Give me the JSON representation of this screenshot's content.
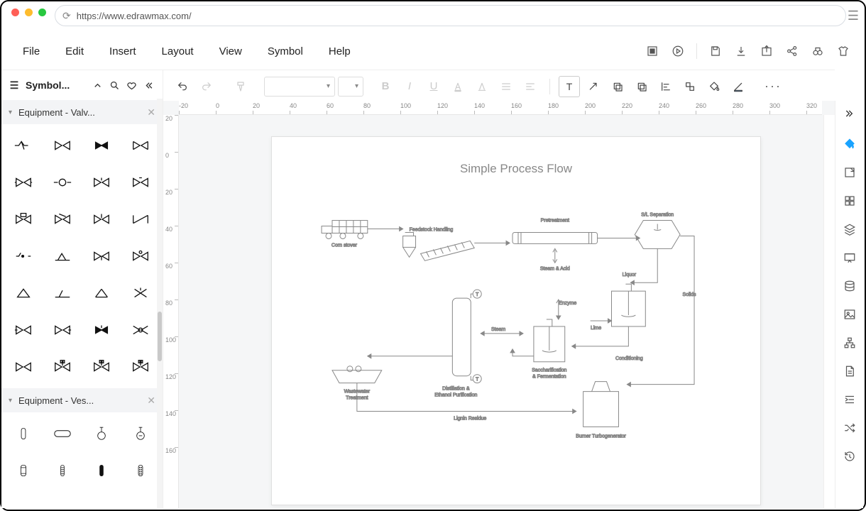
{
  "url": "https://www.edrawmax.com/",
  "menubar": {
    "items": [
      "File",
      "Edit",
      "Insert",
      "Layout",
      "View",
      "Symbol",
      "Help"
    ]
  },
  "right_top_icons": [
    "fullscreen-icon",
    "play-icon",
    "save-icon",
    "download-icon",
    "export-icon",
    "share-icon",
    "binoculars-icon",
    "shirt-icon"
  ],
  "left": {
    "heading": "Symbol...",
    "cat1": "Equipment - Valv...",
    "cat2": "Equipment - Ves..."
  },
  "ruler_h": [
    "-20",
    "0",
    "20",
    "40",
    "60",
    "80",
    "100",
    "120",
    "140",
    "160",
    "180",
    "200",
    "220",
    "240",
    "260",
    "280",
    "300",
    "320"
  ],
  "ruler_v": [
    "20",
    "0",
    "20",
    "40",
    "60",
    "80",
    "100",
    "120",
    "140",
    "160"
  ],
  "diagram": {
    "title": "Simple Process Flow",
    "labels": {
      "corn_stover": "Corn stover",
      "feedstock": "Feedstock Handling",
      "pretreatment": "Pretreatment",
      "sl_sep": "S/L Separation",
      "steam_acid": "Steam & Acid",
      "liquor": "Liquor",
      "solids": "Solids",
      "steam": "Steam",
      "enzyme": "Enzyme",
      "lime": "Lime",
      "conditioning": "Conditioning",
      "sacc_ferm1": "Saccharification",
      "sacc_ferm2": "& Fermentation",
      "dist1": "Distillation &",
      "dist2": "Ethanol Purification",
      "wastewater1": "Wastewater",
      "wastewater2": "Treatment",
      "lignin": "Lignin Residue",
      "burner": "Burner Turbogenerator"
    }
  },
  "right_rail_icons": [
    "paint-bucket-icon",
    "export-panel-icon",
    "grid-icon",
    "layers-icon",
    "presentation-icon",
    "database-icon",
    "image-icon",
    "sitemap-icon",
    "document-icon",
    "indent-icon",
    "shuffle-icon",
    "history-icon"
  ]
}
